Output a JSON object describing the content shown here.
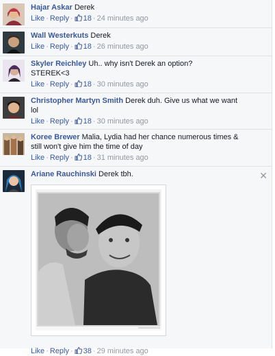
{
  "comments": [
    {
      "author": "Hajar Askar",
      "text": "Derek",
      "like": "Like",
      "reply": "Reply",
      "likes": "18",
      "time": "24 minutes ago"
    },
    {
      "author": "Wall Westerkuts",
      "text": "Derek",
      "like": "Like",
      "reply": "Reply",
      "likes": "18",
      "time": "26 minutes ago"
    },
    {
      "author": "Skyler Reichley",
      "text": "Uh.. why isn't Derek an option?",
      "text2": "STEREK<3",
      "like": "Like",
      "reply": "Reply",
      "likes": "18",
      "time": "30 minutes ago"
    },
    {
      "author": "Christopher Martyn Smith",
      "text": "Derek duh. Give us what we want",
      "text2": "lol",
      "like": "Like",
      "reply": "Reply",
      "likes": "18",
      "time": "30 minutes ago"
    },
    {
      "author": "Koree Brewer",
      "text": "Malia, Lydia had her chance numerous times &",
      "text2": "still won't give him the time of day",
      "like": "Like",
      "reply": "Reply",
      "likes": "18",
      "time": "31 minutes ago"
    },
    {
      "author": "Ariane Rauchinski",
      "text": "Derek tbh.",
      "like": "Like",
      "reply": "Reply",
      "likes": "38",
      "time": "29 minutes ago",
      "close": "✕"
    }
  ],
  "colors": {
    "link": "#3b5998",
    "meta": "#9197a3",
    "border": "#e1e2e5"
  },
  "icons": {
    "like": "thumbs-up-icon",
    "close": "close-icon"
  }
}
